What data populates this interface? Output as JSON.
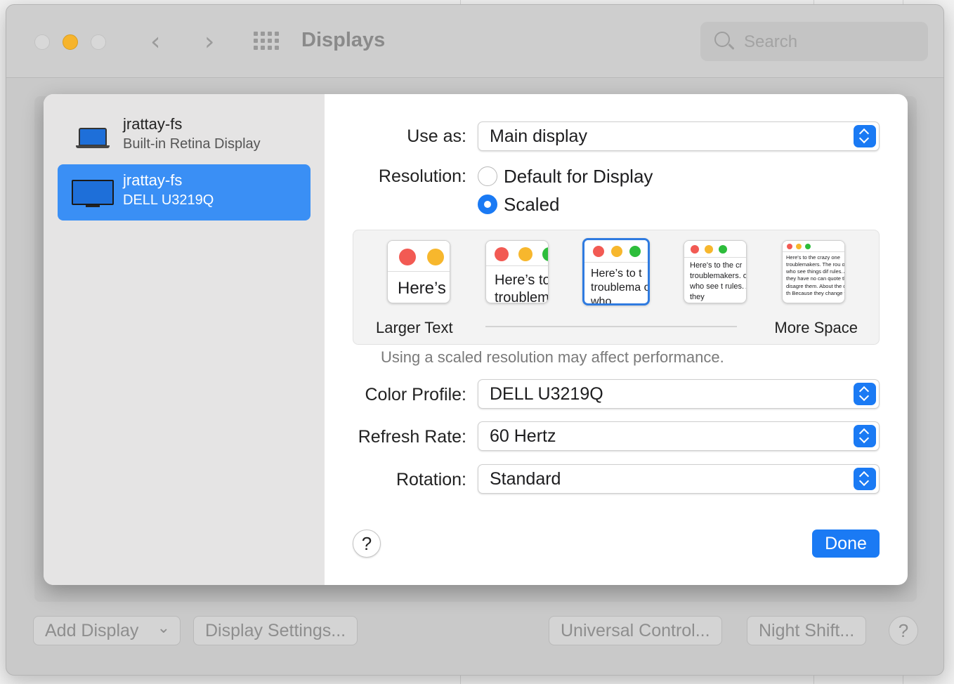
{
  "window": {
    "title": "Displays",
    "search_placeholder": "Search",
    "back_glyph": "‹",
    "forward_glyph": "›"
  },
  "bottom_bar": {
    "add_display": "Add Display",
    "add_display_chevron": "⌄",
    "display_settings": "Display Settings...",
    "universal_control": "Universal Control...",
    "night_shift": "Night Shift...",
    "help": "?"
  },
  "sidebar": {
    "displays": [
      {
        "name": "jrattay-fs",
        "subtitle": "Built-in Retina Display",
        "icon": "laptop-icon",
        "selected": false
      },
      {
        "name": "jrattay-fs",
        "subtitle": "DELL U3219Q",
        "icon": "monitor-icon",
        "selected": true
      }
    ]
  },
  "settings": {
    "use_as_label": "Use as:",
    "use_as_value": "Main display",
    "resolution_label": "Resolution:",
    "resolution_options": [
      "Default for Display",
      "Scaled"
    ],
    "resolution_selected": "Scaled",
    "scale_thumbs": [
      {
        "text": "Here’s"
      },
      {
        "text": "Here’s to troublem"
      },
      {
        "text": "Here’s to t troublema ones who"
      },
      {
        "text": "Here's to the cr troublemakers. ones who see t rules. And they"
      },
      {
        "text": "Here's to the crazy one troublemakers. The rou ones who see things dif rules. And they have no can quote them, disagre them. About the only th Because they change t"
      }
    ],
    "scale_selected_index": 2,
    "larger_text_label": "Larger Text",
    "more_space_label": "More Space",
    "performance_note": "Using a scaled resolution may affect performance.",
    "color_profile_label": "Color Profile:",
    "color_profile_value": "DELL U3219Q",
    "refresh_rate_label": "Refresh Rate:",
    "refresh_rate_value": "60 Hertz",
    "rotation_label": "Rotation:",
    "rotation_value": "Standard"
  },
  "sheet_buttons": {
    "help": "?",
    "done": "Done"
  },
  "colors": {
    "accent": "#1a7af4",
    "selection": "#3a8ff5",
    "traffic_red": "#f25a53",
    "traffic_yellow": "#f7b72d",
    "traffic_green": "#2dbd3b"
  }
}
